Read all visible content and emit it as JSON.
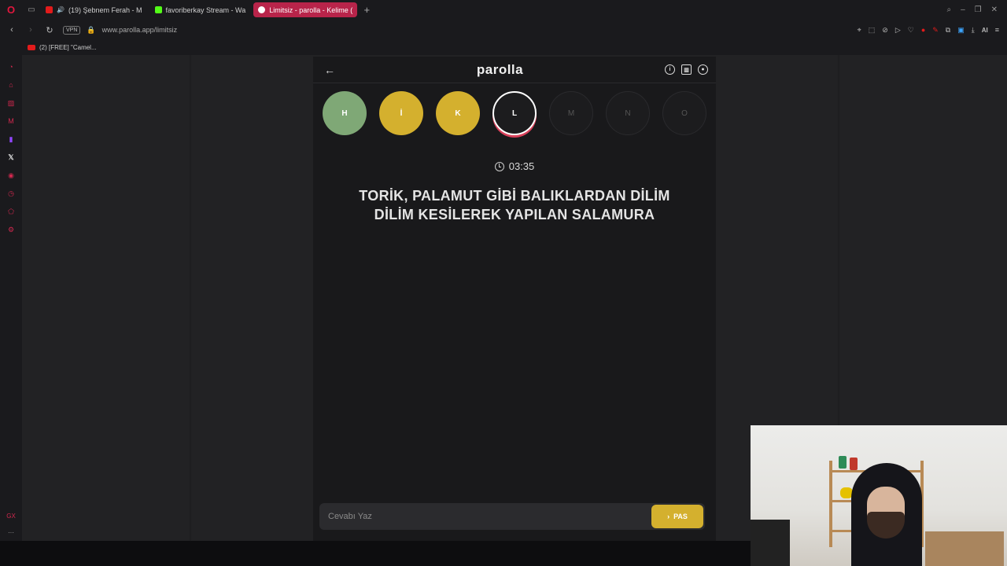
{
  "browser": {
    "tabs": [
      {
        "label": "(19) Şebnem Ferah - M",
        "color": "#e21b1b",
        "active": false
      },
      {
        "label": "favoriberkay Stream - Wa",
        "color": "#53fc18",
        "active": false
      },
      {
        "label": "Limitsiz - parolla - Kelime (",
        "color": "#ffffff",
        "active": true
      }
    ],
    "url": "www.parolla.app/limitsiz",
    "vpn_label": "VPN",
    "ai_label": "AI",
    "bookmark": "(2) [FREE] \"Camel..."
  },
  "app": {
    "logo": "parolla",
    "letters": [
      {
        "letter": "H",
        "state": "correct"
      },
      {
        "letter": "İ",
        "state": "passed"
      },
      {
        "letter": "K",
        "state": "passed"
      },
      {
        "letter": "L",
        "state": "current"
      },
      {
        "letter": "M",
        "state": "pending"
      },
      {
        "letter": "N",
        "state": "pending"
      },
      {
        "letter": "O",
        "state": "pending"
      }
    ],
    "timer": "03:35",
    "question": "TORİK, PALAMUT GİBİ BALIKLARDAN DİLİM DİLİM KESİLEREK YAPILAN SALAMURA",
    "answer_placeholder": "Cevabı Yaz",
    "pass_label": "PAS"
  },
  "colors": {
    "correct": "#7fa876",
    "passed": "#d4b02e",
    "current_ring": "#d9415b",
    "active_tab": "#b8244a"
  }
}
